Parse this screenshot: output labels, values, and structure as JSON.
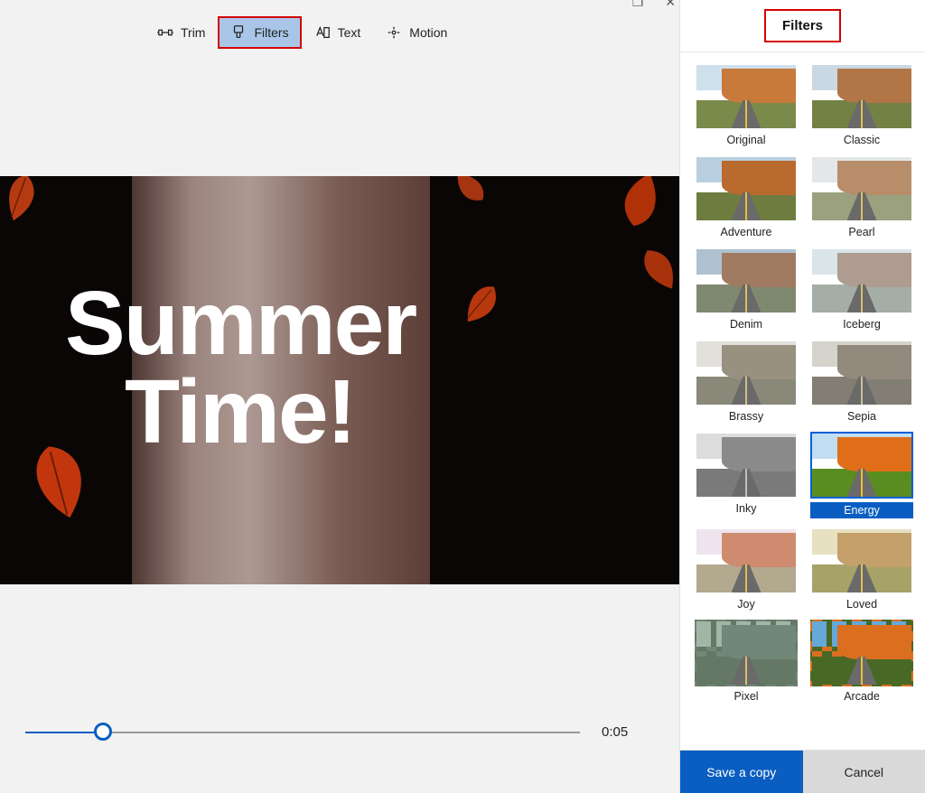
{
  "toolbar": {
    "trim": "Trim",
    "filters": "Filters",
    "text": "Text",
    "motion": "Motion",
    "active": "filters"
  },
  "preview": {
    "overlay_text_line1": "Summer",
    "overlay_text_line2": "Time!"
  },
  "timeline": {
    "position_pct": 14,
    "time_label": "0:05"
  },
  "panel": {
    "title": "Filters",
    "filters": [
      {
        "name": "Original",
        "sky": "#cfe0ed",
        "rock": "#c77a3a",
        "ground": "#7a8a4a",
        "sat": 1
      },
      {
        "name": "Classic",
        "sky": "#c8d8e4",
        "rock": "#b87540",
        "ground": "#72823f",
        "sat": 0.9
      },
      {
        "name": "Adventure",
        "sky": "#b9cfdf",
        "rock": "#b96a2e",
        "ground": "#6e7d3f",
        "sat": 1
      },
      {
        "name": "Pearl",
        "sky": "#e2e7ea",
        "rock": "#c68a58",
        "ground": "#9aa372",
        "sat": 0.7
      },
      {
        "name": "Denim",
        "sky": "#aac2d6",
        "rock": "#a87a5a",
        "ground": "#7e8a6a",
        "sat": 0.8
      },
      {
        "name": "Iceberg",
        "sky": "#d4e6ef",
        "rock": "#b89a86",
        "ground": "#9fb0a4",
        "sat": 0.6
      },
      {
        "name": "Brassy",
        "sky": "#e4e0d6",
        "rock": "#a0906f",
        "ground": "#8c8a6a",
        "sat": 0.5
      },
      {
        "name": "Sepia",
        "sky": "#ddd2bf",
        "rock": "#a48860",
        "ground": "#8c7d5c",
        "sat": 0.3
      },
      {
        "name": "Inky",
        "sky": "#dcdcdc",
        "rock": "#8a8a8a",
        "ground": "#7a7a7a",
        "sat": 0.05
      },
      {
        "name": "Energy",
        "sky": "#c6dced",
        "rock": "#d0712a",
        "ground": "#5f8a2e",
        "sat": 1.2
      },
      {
        "name": "Joy",
        "sky": "#f0e4ee",
        "rock": "#d48a6a",
        "ground": "#b4a98c",
        "sat": 0.9
      },
      {
        "name": "Loved",
        "sky": "#e8e0bc",
        "rock": "#caa060",
        "ground": "#a8a45e",
        "sat": 0.85
      },
      {
        "name": "Pixel",
        "sky": "#9cb8a4",
        "rock": "#6a8a72",
        "ground": "#5e7a60",
        "sat": 0.7,
        "pixel": true
      },
      {
        "name": "Arcade",
        "sky": "#6aa8d4",
        "rock": "#d47028",
        "ground": "#4a682a",
        "sat": 1.1,
        "pixel": true
      }
    ],
    "selected": "Energy",
    "save_label": "Save a copy",
    "cancel_label": "Cancel"
  }
}
